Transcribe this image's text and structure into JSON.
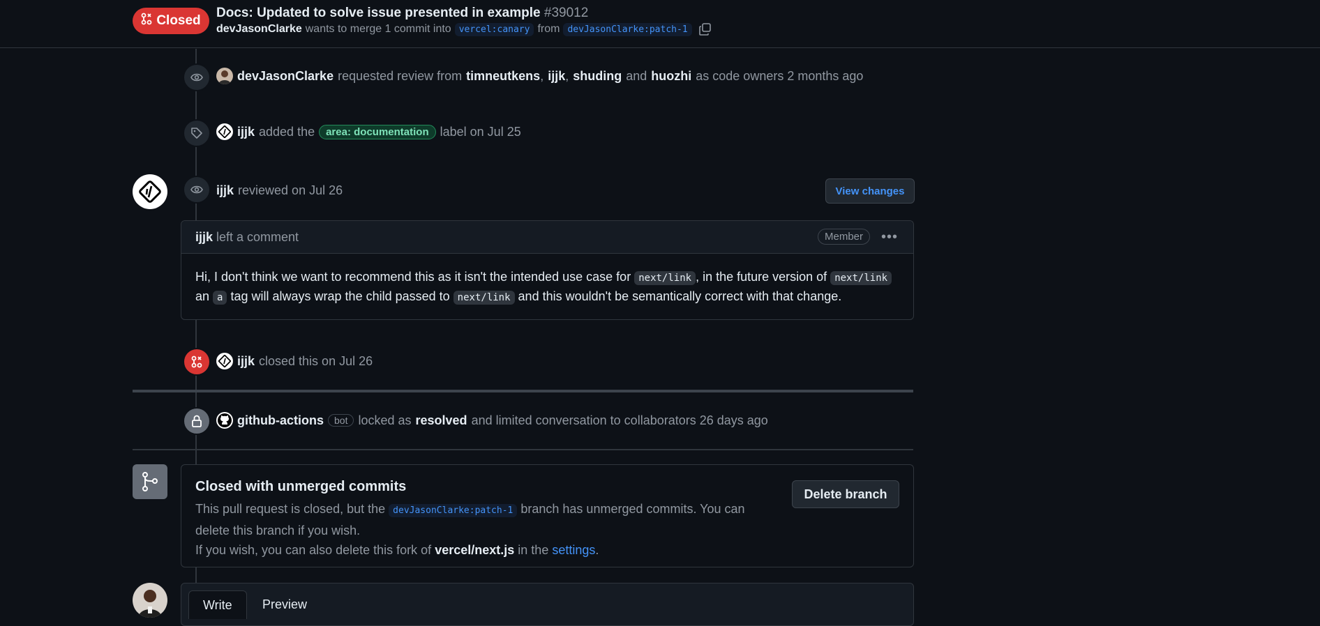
{
  "header": {
    "state": "Closed",
    "title": "Docs: Updated to solve issue presented in example",
    "number": "#39012",
    "author": "devJasonClarke",
    "merge_text": "wants to merge 1 commit into",
    "base_branch": "vercel:canary",
    "from_text": "from",
    "head_branch": "devJasonClarke:patch-1"
  },
  "timeline": {
    "review_request": {
      "actor": "devJasonClarke",
      "text1": "requested review from",
      "reviewer1": "timneutkens",
      "sep1": ",",
      "reviewer2": "ijjk",
      "sep2": ",",
      "reviewer3": "shuding",
      "and": "and",
      "reviewer4": "huozhi",
      "suffix": "as code owners 2 months ago"
    },
    "label_event": {
      "actor": "ijjk",
      "text1": "added the",
      "label": "area: documentation",
      "suffix": "label on Jul 25"
    },
    "review": {
      "actor": "ijjk",
      "text": "reviewed on Jul 26",
      "view_changes": "View changes"
    },
    "comment": {
      "author": "ijjk",
      "action": "left a comment",
      "badge": "Member",
      "menu": "•••",
      "p1": "Hi, I don't think we want to recommend this as it isn't the intended use case for",
      "code1": "next/link",
      "p2": ", in the future version of",
      "code2": "next/link",
      "p3": "an",
      "code3": "a",
      "p4": "tag will always wrap the child passed to",
      "code4": "next/link",
      "p5": "and this wouldn't be semantically correct with that change."
    },
    "closed_event": {
      "actor": "ijjk",
      "text": "closed this on Jul 26"
    },
    "locked_event": {
      "actor": "github-actions",
      "bot": "bot",
      "text1": "locked as",
      "reason": "resolved",
      "text2": "and limited conversation to collaborators 26 days ago"
    }
  },
  "merge_box": {
    "title": "Closed with unmerged commits",
    "desc1": "This pull request is closed, but the",
    "branch": "devJasonClarke:patch-1",
    "desc2": "branch has unmerged commits. You can delete this branch if you wish.",
    "desc3": "If you wish, you can also delete this fork of",
    "repo": "vercel/next.js",
    "desc4": "in the",
    "settings_link": "settings",
    "period": ".",
    "delete_button": "Delete branch"
  },
  "composer": {
    "tab_write": "Write",
    "tab_preview": "Preview"
  },
  "colors": {
    "background": "#0d1117",
    "closed_red": "#da3633",
    "link_blue": "#4493f8",
    "label_green": "#7ee2b8"
  }
}
